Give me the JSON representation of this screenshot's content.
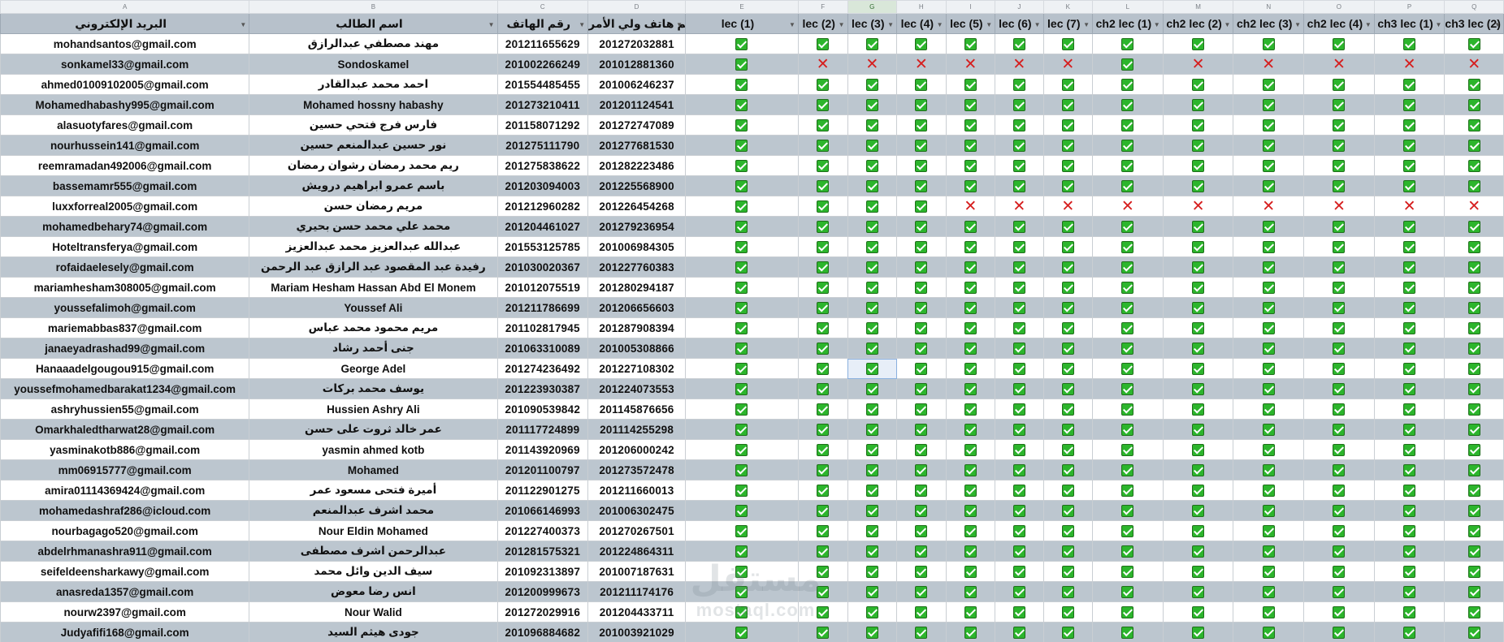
{
  "columns": {
    "letters": [
      "A",
      "B",
      "C",
      "D",
      "E",
      "F",
      "G",
      "H",
      "I",
      "J",
      "K",
      "L",
      "M",
      "N",
      "O",
      "P",
      "Q"
    ],
    "selected_letter": "G",
    "headers": [
      "البريد الإلكتروني",
      "اسم الطالب",
      "رقم الهاتف",
      "رقم هاتف ولي الأمر",
      "lec (1)",
      "lec (2)",
      "lec (3)",
      "lec (4)",
      "lec (5)",
      "lec (6)",
      "lec (7)",
      "ch2 lec (1)",
      "ch2 lec (2)",
      "ch2 lec (3)",
      "ch2 lec (4)",
      "ch3 lec (1)",
      "ch3 lec (2)"
    ]
  },
  "active_cell": {
    "row": 16,
    "col": 6
  },
  "marks": {
    "check": "✓",
    "cross": "✕"
  },
  "colors": {
    "check_green": "#2cb52c",
    "cross_red": "#d61e1e",
    "header_bg": "#b7c1cb",
    "band_bg": "#bcc6cf"
  },
  "rows": [
    {
      "email": "mohandsantos@gmail.com",
      "name": "مهند مصطفي عبدالرازق",
      "phone": "201211655629",
      "parent_phone": "201272032881",
      "att": "1111111111111"
    },
    {
      "email": "sonkamel33@gmail.com",
      "name": "Sondoskamel",
      "phone": "201002266249",
      "parent_phone": "201012881360",
      "att": "1000000100000"
    },
    {
      "email": "ahmed01009102005@gmail.com",
      "name": "احمد محمد عبدالقادر",
      "phone": "201554485455",
      "parent_phone": "201006246237",
      "att": "1111111111111"
    },
    {
      "email": "Mohamedhabashy995@gmail.com",
      "name": "Mohamed hossny habashy",
      "phone": "201273210411",
      "parent_phone": "201201124541",
      "att": "1111111111111"
    },
    {
      "email": "alasuotyfares@gmail.com",
      "name": "فارس فرج فتحي حسين",
      "phone": "201158071292",
      "parent_phone": "201272747089",
      "att": "1111111111111"
    },
    {
      "email": "nourhussein141@gmail.com",
      "name": "نور حسين عبدالمنعم حسين",
      "phone": "201275111790",
      "parent_phone": "201277681530",
      "att": "1111111111111"
    },
    {
      "email": "reemramadan492006@gmail.com",
      "name": "ريم محمد رمضان رشوان رمضان",
      "phone": "201275838622",
      "parent_phone": "201282223486",
      "att": "1111111111111"
    },
    {
      "email": "bassemamr555@gmail.com",
      "name": "باسم عمرو ابراهيم درويش",
      "phone": "201203094003",
      "parent_phone": "201225568900",
      "att": "1111111111111"
    },
    {
      "email": "luxxforreal2005@gmail.com",
      "name": "مريم رمضان حسن",
      "phone": "201212960282",
      "parent_phone": "201226454268",
      "att": "1111000000000"
    },
    {
      "email": "mohamedbehary74@gmail.com",
      "name": "محمد علي محمد حسن بحيري",
      "phone": "201204461027",
      "parent_phone": "201279236954",
      "att": "1111111111111"
    },
    {
      "email": "Hoteltransferya@gmail.com",
      "name": "عبدالله عبدالعزيز محمد عبدالعزيز",
      "phone": "201553125785",
      "parent_phone": "201006984305",
      "att": "1111111111111"
    },
    {
      "email": "rofaidaelesely@gmail.com",
      "name": "رفيدة عبد المقصود عبد الرازق عبد الرحمن",
      "phone": "201030020367",
      "parent_phone": "201227760383",
      "att": "1111111111111"
    },
    {
      "email": "mariamhesham308005@gmail.com",
      "name": "Mariam Hesham Hassan Abd El Monem",
      "phone": "201012075519",
      "parent_phone": "201280294187",
      "att": "1111111111111"
    },
    {
      "email": "youssefalimoh@gmail.com",
      "name": "Youssef Ali",
      "phone": "201211786699",
      "parent_phone": "201206656603",
      "att": "1111111111111"
    },
    {
      "email": "mariemabbas837@gmail.com",
      "name": "مريم محمود محمد عباس",
      "phone": "201102817945",
      "parent_phone": "201287908394",
      "att": "1111111111111"
    },
    {
      "email": "janaeyadrashad99@gmail.com",
      "name": "جنى أحمد رشاد",
      "phone": "201063310089",
      "parent_phone": "201005308866",
      "att": "1111111111111"
    },
    {
      "email": "Hanaaadelgougou915@gmail.com",
      "name": "George Adel",
      "phone": "201274236492",
      "parent_phone": "201227108302",
      "att": "1111111111111"
    },
    {
      "email": "youssefmohamedbarakat1234@gmail.com",
      "name": "يوسف محمد بركات",
      "phone": "201223930387",
      "parent_phone": "201224073553",
      "att": "1111111111111"
    },
    {
      "email": "ashryhussien55@gmail.com",
      "name": "Hussien Ashry Ali",
      "phone": "201090539842",
      "parent_phone": "201145876656",
      "att": "1111111111111"
    },
    {
      "email": "Omarkhaledtharwat28@gmail.com",
      "name": "عمر خالد ثروت على حسن",
      "phone": "201117724899",
      "parent_phone": "201114255298",
      "att": "1111111111111"
    },
    {
      "email": "yasminakotb886@gmail.com",
      "name": "yasmin ahmed kotb",
      "phone": "201143920969",
      "parent_phone": "201206000242",
      "att": "1111111111111"
    },
    {
      "email": "mm06915777@gmail.com",
      "name": "Mohamed",
      "phone": "201201100797",
      "parent_phone": "201273572478",
      "att": "1111111111111"
    },
    {
      "email": "amira01114369424@gmail.com",
      "name": "أميرة فتحى مسعود عمر",
      "phone": "201122901275",
      "parent_phone": "201211660013",
      "att": "1111111111111"
    },
    {
      "email": "mohamedashraf286@icloud.com",
      "name": "محمد اشرف عبدالمنعم",
      "phone": "201066146993",
      "parent_phone": "201006302475",
      "att": "1111111111111"
    },
    {
      "email": "nourbagago520@gmail.com",
      "name": "Nour Eldin Mohamed",
      "phone": "201227400373",
      "parent_phone": "201270267501",
      "att": "1111111111111"
    },
    {
      "email": "abdelrhmanashra911@gmail.com",
      "name": "عبدالرحمن اشرف مصطفى",
      "phone": "201281575321",
      "parent_phone": "201224864311",
      "att": "1111111111111"
    },
    {
      "email": "seifeldeensharkawy@gmail.com",
      "name": "سيف الدين وائل محمد",
      "phone": "201092313897",
      "parent_phone": "201007187631",
      "att": "1111111111111"
    },
    {
      "email": "anasreda1357@gmail.com",
      "name": "انس رضا معوض",
      "phone": "201200999673",
      "parent_phone": "201211174176",
      "att": "1111111111111"
    },
    {
      "email": "nourw2397@gmail.com",
      "name": "Nour Walid",
      "phone": "201272029916",
      "parent_phone": "201204433711",
      "att": "1111111111111"
    },
    {
      "email": "Judyafifi168@gmail.com",
      "name": "جودى هيثم السيد",
      "phone": "201096884682",
      "parent_phone": "201003921029",
      "att": "1111111111111"
    }
  ],
  "watermark": {
    "line1": "مستقل",
    "line2": "mostaql.com"
  }
}
